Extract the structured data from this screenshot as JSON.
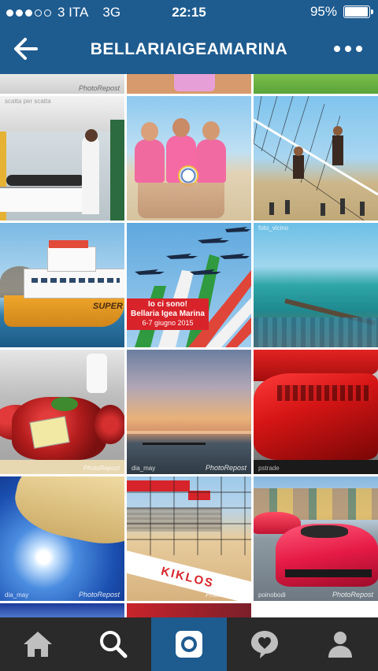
{
  "status": {
    "carrier": "3 ITA",
    "network": "3G",
    "time": "22:15",
    "battery": "95%",
    "battery_level": 0.95,
    "signal_bars_filled": 3,
    "signal_bars_total": 5
  },
  "header": {
    "title": "BELLARIAIGEAMARINA",
    "back_icon": "arrow-left-icon",
    "more_icon": "ellipsis-icon"
  },
  "colors": {
    "brand": "#1e5b8f",
    "tabbar": "#2a2a2a",
    "tab_active": "#1e5b8f"
  },
  "grid": {
    "watermark": "PhotoRepost",
    "overlay": {
      "line1": "Io ci sono!",
      "line2": "Bellaria Igea Marina",
      "line3": "6-7 giugno 2015"
    },
    "ferry_label": "SUPER",
    "banner_text": "KIKLOS"
  },
  "tabs": [
    {
      "name": "home",
      "icon": "home-icon"
    },
    {
      "name": "explore",
      "icon": "search-icon"
    },
    {
      "name": "camera",
      "icon": "camera-icon",
      "active": true
    },
    {
      "name": "activity",
      "icon": "heart-bubble-icon"
    },
    {
      "name": "profile",
      "icon": "person-icon"
    }
  ]
}
